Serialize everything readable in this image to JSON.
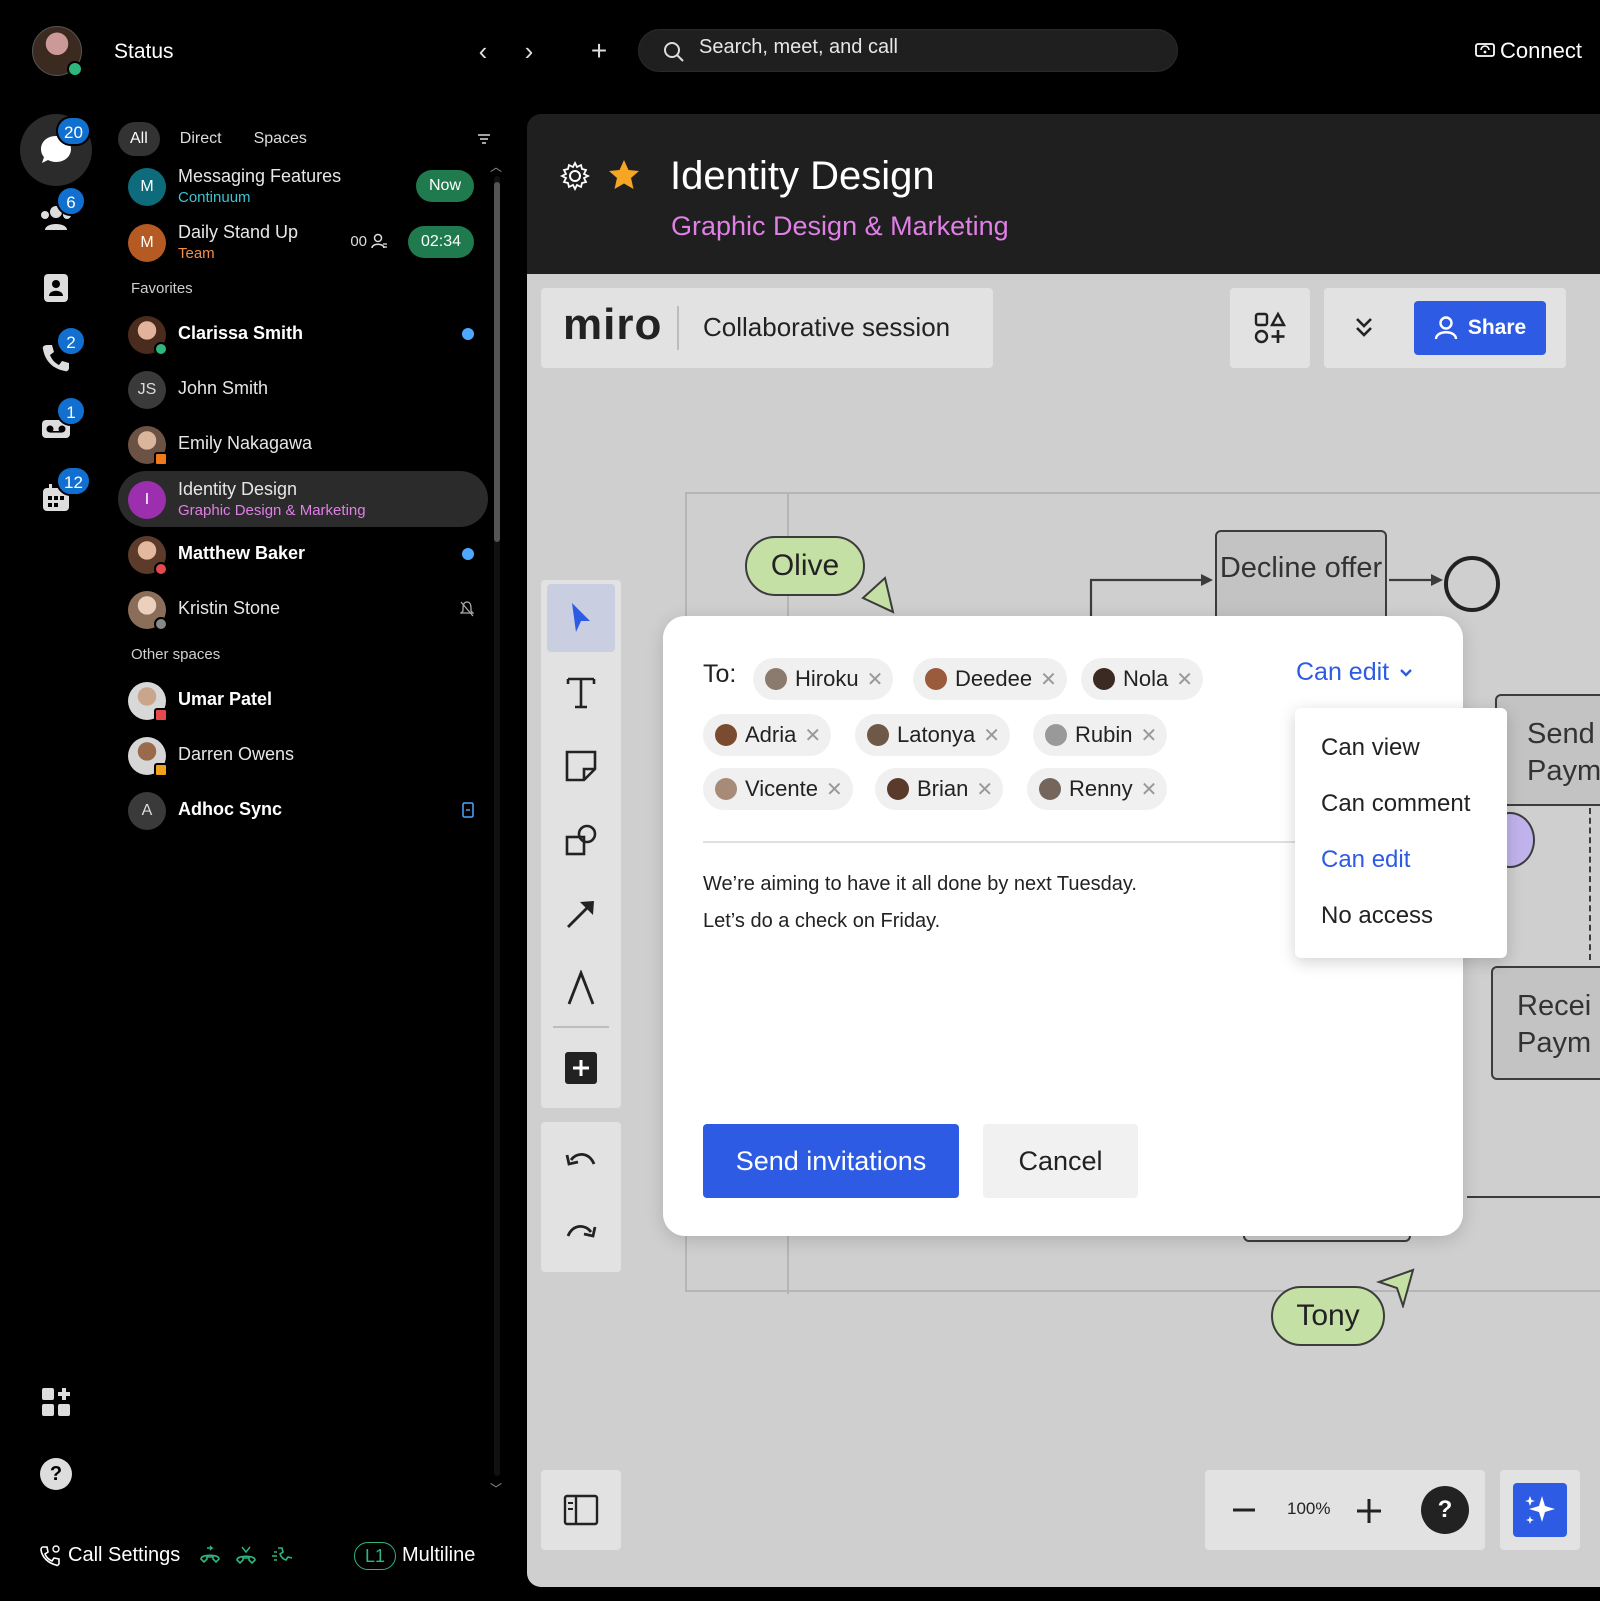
{
  "header": {
    "status_label": "Status",
    "search_placeholder": "Search, meet, and call",
    "connect_label": "Connect"
  },
  "rail": {
    "messaging_badge": "20",
    "teams_badge": "6",
    "calls_badge": "2",
    "voicemail_badge": "1",
    "calendar_badge": "12"
  },
  "list": {
    "filters": [
      "All",
      "Direct",
      "Spaces"
    ],
    "pinned": [
      {
        "initial": "M",
        "name": "Messaging Features",
        "sub": "Continuum",
        "pill": "Now"
      },
      {
        "initial": "M",
        "name": "Daily Stand Up",
        "sub": "Team",
        "count": "00",
        "pill": "02:34"
      }
    ],
    "favorites_label": "Favorites",
    "favorites": [
      {
        "name": "Clarissa Smith"
      },
      {
        "initial": "JS",
        "name": "John Smith"
      },
      {
        "name": "Emily Nakagawa"
      },
      {
        "initial": "I",
        "name": "Identity Design",
        "sub": "Graphic Design & Marketing"
      },
      {
        "name": "Matthew Baker"
      },
      {
        "name": "Kristin Stone"
      }
    ],
    "other_label": "Other spaces",
    "other": [
      {
        "name": "Umar Patel"
      },
      {
        "name": "Darren Owens"
      },
      {
        "initial": "A",
        "name": "Adhoc Sync"
      }
    ]
  },
  "bottom": {
    "call_settings": "Call Settings",
    "line_label": "L1",
    "multiline": "Multiline"
  },
  "space": {
    "title": "Identity Design",
    "subtitle": "Graphic Design & Marketing"
  },
  "miro": {
    "logo": "miro",
    "session_title": "Collaborative session",
    "share_label": "Share",
    "zoom": "100%",
    "help": "?",
    "stickers": {
      "olive": "Olive",
      "tony": "Tony"
    },
    "nodes": {
      "decline": "Decline offer",
      "send_payment": "Send Paym",
      "receive_payment": "Recei Paym"
    }
  },
  "invite": {
    "to_label": "To:",
    "recipients": [
      "Hiroku",
      "Deedee",
      "Nola",
      "Adria",
      "Latonya",
      "Rubin",
      "Vicente",
      "Brian",
      "Renny"
    ],
    "permission": "Can edit",
    "message_line1": "We’re aiming to have it all done by next Tuesday.",
    "message_line2": "Let’s do a check on Friday.",
    "send_label": "Send invitations",
    "cancel_label": "Cancel",
    "options": [
      "Can view",
      "Can comment",
      "Can edit",
      "No access"
    ]
  },
  "colors": {
    "accent_blue": "#2d5be3",
    "space_pink": "#e07fe6",
    "online_green": "#2fb67c",
    "badge_blue": "#1170cf",
    "sticker_green": "#c5e0a5"
  }
}
